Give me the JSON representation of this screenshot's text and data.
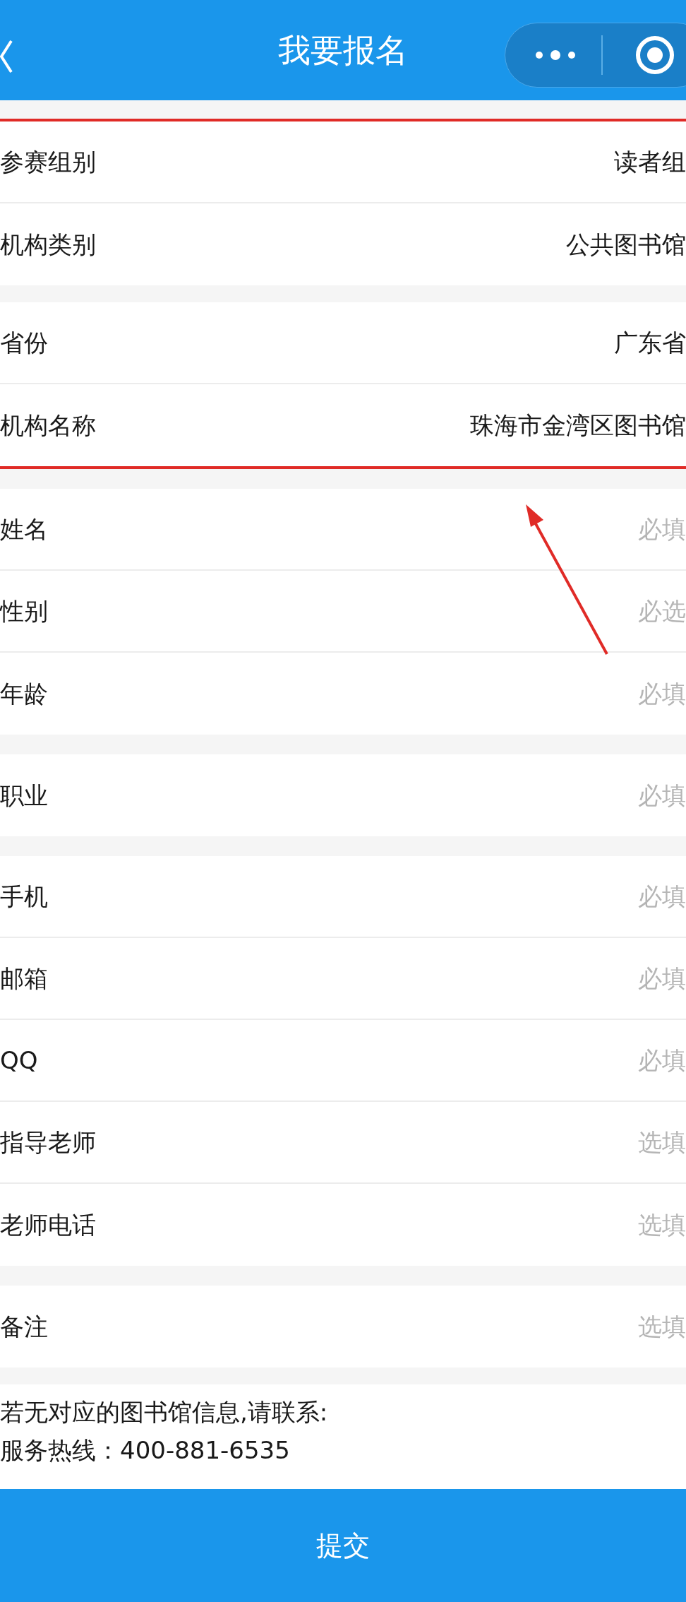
{
  "nav_bar": {
    "title": "我要报名"
  },
  "highlighted_groups": [
    {
      "rows": [
        {
          "label": "参赛组别",
          "value": "读者组"
        },
        {
          "label": "机构类别",
          "value": "公共图书馆"
        }
      ]
    },
    {
      "rows": [
        {
          "label": "省份",
          "value": "广东省"
        },
        {
          "label": "机构名称",
          "value": "珠海市金湾区图书馆"
        }
      ]
    }
  ],
  "groups": [
    {
      "rows": [
        {
          "label": "姓名",
          "placeholder": "必填"
        },
        {
          "label": "性别",
          "placeholder": "必选"
        },
        {
          "label": "年龄",
          "placeholder": "必填"
        }
      ]
    },
    {
      "rows": [
        {
          "label": "职业",
          "placeholder": "必填"
        }
      ]
    },
    {
      "rows": [
        {
          "label": "手机",
          "placeholder": "必填"
        },
        {
          "label": "邮箱",
          "placeholder": "必填"
        },
        {
          "label": "QQ",
          "placeholder": "必填"
        },
        {
          "label": "指导老师",
          "placeholder": "选填"
        },
        {
          "label": "老师电话",
          "placeholder": "选填"
        }
      ]
    },
    {
      "rows": [
        {
          "label": "备注",
          "placeholder": "选填"
        }
      ]
    }
  ],
  "notice": [
    "若无对应的图书馆信息,请联系:",
    "服务热线：400-881-6535"
  ],
  "submit_button": "提交"
}
